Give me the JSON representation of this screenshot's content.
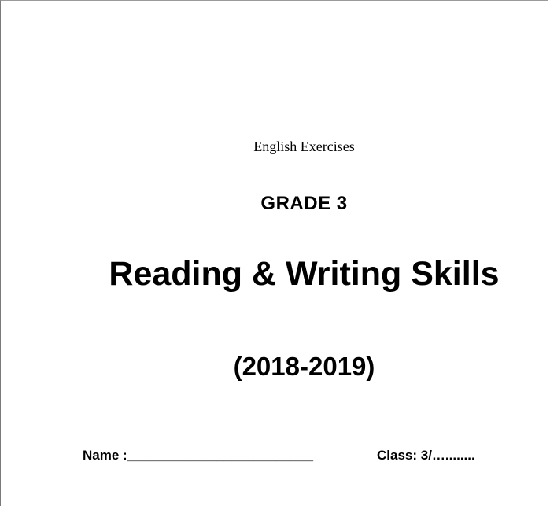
{
  "document": {
    "subject": "English Exercises",
    "grade": "GRADE 3",
    "title": "Reading & Writing Skills",
    "year": "(2018-2019)",
    "name_line": "Name :_________________________",
    "class_line": "Class: 3/…........"
  }
}
